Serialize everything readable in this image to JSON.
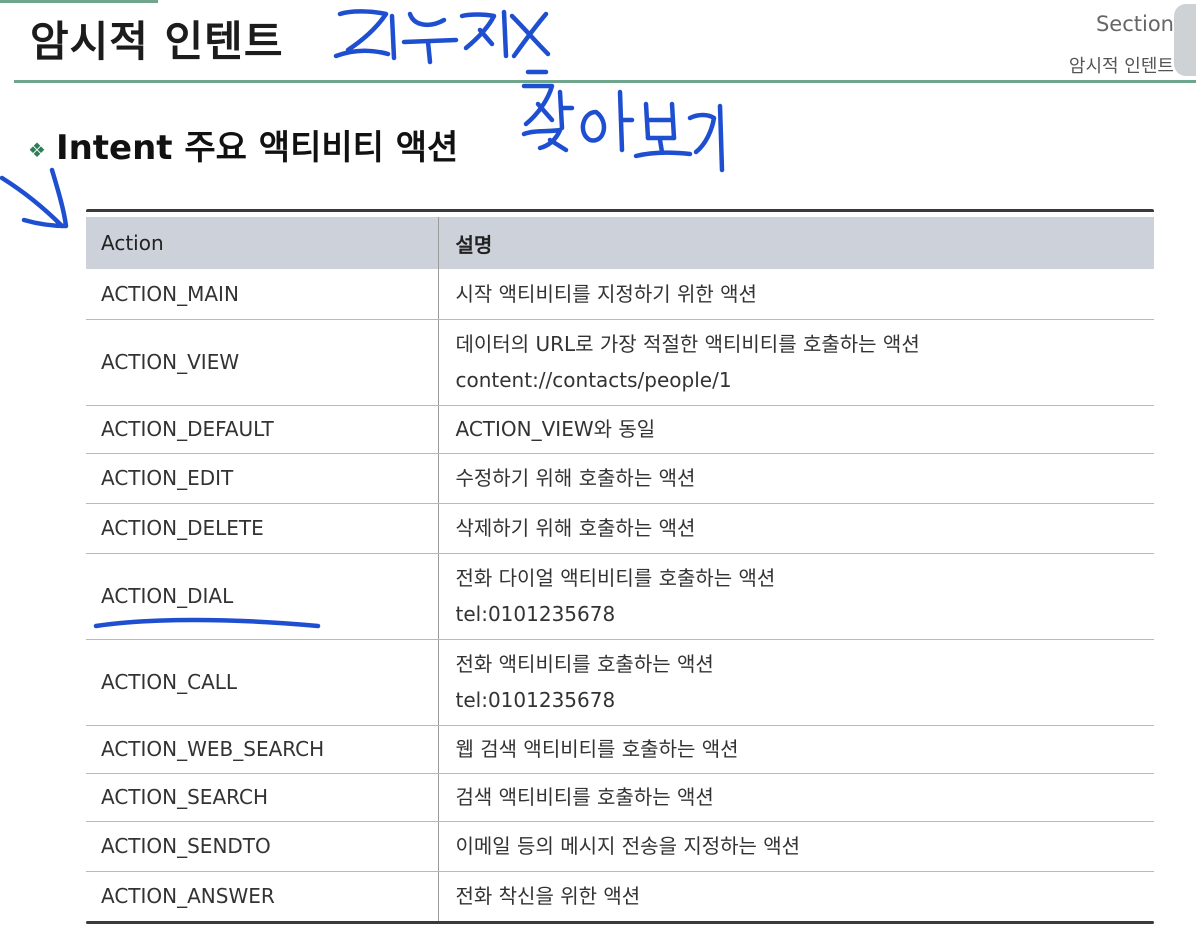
{
  "header": {
    "title": "암시적 인텐트",
    "section_label": "Section",
    "section_sub": "암시적 인텐트"
  },
  "subheading": {
    "bullet": "❖",
    "text": "Intent 주요 액티비티 액션"
  },
  "table": {
    "columns": [
      "Action",
      "설명"
    ],
    "rows": [
      {
        "action": "ACTION_MAIN",
        "desc": [
          "시작 액티비티를 지정하기 위한 액션"
        ]
      },
      {
        "action": "ACTION_VIEW",
        "desc": [
          "데이터의 URL로 가장 적절한 액티비티를 호출하는 액션",
          "content://contacts/people/1"
        ]
      },
      {
        "action": "ACTION_DEFAULT",
        "desc": [
          "ACTION_VIEW와 동일"
        ]
      },
      {
        "action": "ACTION_EDIT",
        "desc": [
          "수정하기 위해 호출하는 액션"
        ]
      },
      {
        "action": "ACTION_DELETE",
        "desc": [
          "삭제하기 위해 호출하는 액션"
        ]
      },
      {
        "action": "ACTION_DIAL",
        "desc": [
          "전화 다이얼 액티비티를 호출하는 액션",
          "tel:0101235678"
        ]
      },
      {
        "action": "ACTION_CALL",
        "desc": [
          "전화 액티비티를 호출하는 액션",
          "tel:0101235678"
        ]
      },
      {
        "action": "ACTION_WEB_SEARCH",
        "desc": [
          "웹 검색 액티비티를 호출하는 액션"
        ]
      },
      {
        "action": "ACTION_SEARCH",
        "desc": [
          "검색 액티비티를 호출하는 액션"
        ]
      },
      {
        "action": "ACTION_SENDTO",
        "desc": [
          "이메일 등의 메시지 전송을 지정하는 액션"
        ]
      },
      {
        "action": "ACTION_ANSWER",
        "desc": [
          "전화 착신을 위한 액션"
        ]
      }
    ]
  },
  "annotations": {
    "ink_color": "#1f4fd1",
    "handwritten_1": "지우지X",
    "handwritten_2": "찾아보기"
  },
  "colors": {
    "accent": "#6fa58c",
    "header_bg": "#cdd2da"
  }
}
